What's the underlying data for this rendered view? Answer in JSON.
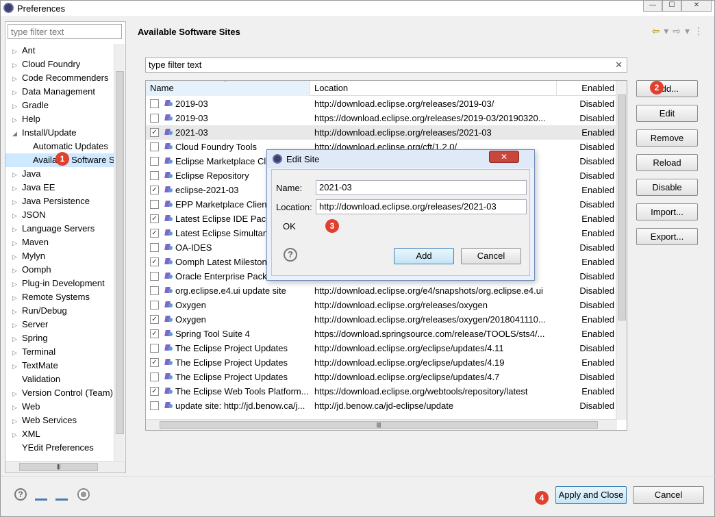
{
  "window": {
    "title": "Preferences"
  },
  "left": {
    "filter_placeholder": "type filter text",
    "tree": [
      {
        "label": "Ant",
        "arrow": "▷"
      },
      {
        "label": "Cloud Foundry",
        "arrow": "▷"
      },
      {
        "label": "Code Recommenders",
        "arrow": "▷"
      },
      {
        "label": "Data Management",
        "arrow": "▷"
      },
      {
        "label": "Gradle",
        "arrow": "▷"
      },
      {
        "label": "Help",
        "arrow": "▷"
      },
      {
        "label": "Install/Update",
        "arrow": "◢"
      },
      {
        "label": "Automatic Updates",
        "arrow": "",
        "child": true
      },
      {
        "label": "Available Software Sites",
        "arrow": "",
        "child": true,
        "selected": true
      },
      {
        "label": "Java",
        "arrow": "▷"
      },
      {
        "label": "Java EE",
        "arrow": "▷"
      },
      {
        "label": "Java Persistence",
        "arrow": "▷"
      },
      {
        "label": "JSON",
        "arrow": "▷"
      },
      {
        "label": "Language Servers",
        "arrow": "▷"
      },
      {
        "label": "Maven",
        "arrow": "▷"
      },
      {
        "label": "Mylyn",
        "arrow": "▷"
      },
      {
        "label": "Oomph",
        "arrow": "▷"
      },
      {
        "label": "Plug-in Development",
        "arrow": "▷"
      },
      {
        "label": "Remote Systems",
        "arrow": "▷"
      },
      {
        "label": "Run/Debug",
        "arrow": "▷"
      },
      {
        "label": "Server",
        "arrow": "▷"
      },
      {
        "label": "Spring",
        "arrow": "▷"
      },
      {
        "label": "Terminal",
        "arrow": "▷"
      },
      {
        "label": "TextMate",
        "arrow": "▷"
      },
      {
        "label": "Validation",
        "arrow": ""
      },
      {
        "label": "Version Control (Team)",
        "arrow": "▷"
      },
      {
        "label": "Web",
        "arrow": "▷"
      },
      {
        "label": "Web Services",
        "arrow": "▷"
      },
      {
        "label": "XML",
        "arrow": "▷"
      },
      {
        "label": "YEdit Preferences",
        "arrow": ""
      }
    ]
  },
  "main": {
    "title": "Available Software Sites",
    "filter_value": "type filter text",
    "columns": [
      "Name",
      "Location",
      "Enabled"
    ],
    "rows": [
      {
        "name": "2019-03",
        "location": "http://download.eclipse.org/releases/2019-03/",
        "enabled": "Disabled",
        "checked": false
      },
      {
        "name": "2019-03",
        "location": "https://download.eclipse.org/releases/2019-03/20190320...",
        "enabled": "Disabled",
        "checked": false
      },
      {
        "name": "2021-03",
        "location": "http://download.eclipse.org/releases/2021-03",
        "enabled": "Enabled",
        "checked": true,
        "selected": true
      },
      {
        "name": "Cloud Foundry Tools",
        "location": "http://download.eclipse.org/cft/1.2.0/",
        "enabled": "Disabled",
        "checked": false
      },
      {
        "name": "Eclipse Marketplace Client",
        "location": "",
        "enabled": "Disabled",
        "checked": false
      },
      {
        "name": "Eclipse Repository",
        "location": "",
        "enabled": "Disabled",
        "checked": false
      },
      {
        "name": "eclipse-2021-03",
        "location": "",
        "enabled": "Enabled",
        "checked": true
      },
      {
        "name": "EPP Marketplace Client",
        "location": "",
        "enabled": "Disabled",
        "checked": false
      },
      {
        "name": "Latest Eclipse IDE Package",
        "location": "s/l...",
        "enabled": "Enabled",
        "checked": true
      },
      {
        "name": "Latest Eclipse Simultaneous",
        "location": "",
        "enabled": "Enabled",
        "checked": true
      },
      {
        "name": "OA-IDES",
        "location": "k.s...",
        "enabled": "Disabled",
        "checked": false
      },
      {
        "name": "Oomph Latest Milestone",
        "location": "/la...",
        "enabled": "Enabled",
        "checked": true
      },
      {
        "name": "Oracle Enterprise Pack",
        "location": "3/o...",
        "enabled": "Disabled",
        "checked": false
      },
      {
        "name": "org.eclipse.e4.ui update site",
        "location": "http://download.eclipse.org/e4/snapshots/org.eclipse.e4.ui",
        "enabled": "Disabled",
        "checked": false
      },
      {
        "name": "Oxygen",
        "location": "http://download.eclipse.org/releases/oxygen",
        "enabled": "Disabled",
        "checked": false
      },
      {
        "name": "Oxygen",
        "location": "http://download.eclipse.org/releases/oxygen/2018041110...",
        "enabled": "Enabled",
        "checked": true
      },
      {
        "name": "Spring Tool Suite 4",
        "location": "https://download.springsource.com/release/TOOLS/sts4/...",
        "enabled": "Enabled",
        "checked": true
      },
      {
        "name": "The Eclipse Project Updates",
        "location": "http://download.eclipse.org/eclipse/updates/4.11",
        "enabled": "Disabled",
        "checked": false
      },
      {
        "name": "The Eclipse Project Updates",
        "location": "http://download.eclipse.org/eclipse/updates/4.19",
        "enabled": "Enabled",
        "checked": true
      },
      {
        "name": "The Eclipse Project Updates",
        "location": "http://download.eclipse.org/eclipse/updates/4.7",
        "enabled": "Disabled",
        "checked": false
      },
      {
        "name": "The Eclipse Web Tools Platform...",
        "location": "https://download.eclipse.org/webtools/repository/latest",
        "enabled": "Enabled",
        "checked": true
      },
      {
        "name": "update site: http://jd.benow.ca/j...",
        "location": "http://jd.benow.ca/jd-eclipse/update",
        "enabled": "Disabled",
        "checked": false
      }
    ],
    "buttons": [
      "Add...",
      "Edit",
      "Remove",
      "Reload",
      "Disable",
      "Import...",
      "Export..."
    ]
  },
  "dialog": {
    "title": "Edit Site",
    "name_label": "Name:",
    "name_value": "2021-03",
    "location_label": "Location:",
    "location_value": "http://download.eclipse.org/releases/2021-03",
    "status": "OK",
    "add_label": "Add",
    "cancel_label": "Cancel",
    "close_glyph": "✕"
  },
  "footer": {
    "apply_close_label": "Apply and Close",
    "cancel_label": "Cancel"
  },
  "badges": [
    "1",
    "2",
    "3",
    "4"
  ]
}
